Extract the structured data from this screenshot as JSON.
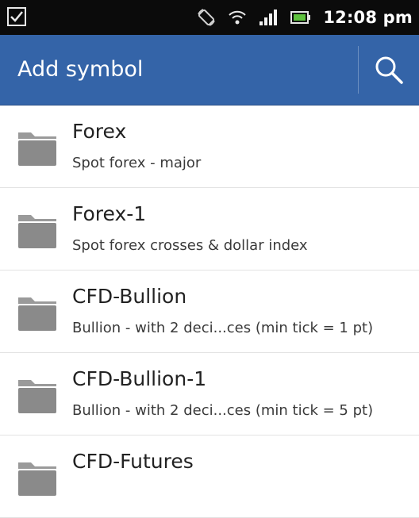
{
  "status_bar": {
    "time": "12:08 pm",
    "icons": [
      "checkbox-notification-icon",
      "rotation-icon",
      "wifi-icon",
      "signal-icon",
      "battery-icon"
    ]
  },
  "action_bar": {
    "title": "Add symbol",
    "search_icon": "search-icon",
    "color": "#3464a8"
  },
  "folders": [
    {
      "name": "Forex",
      "description": "Spot forex - major"
    },
    {
      "name": "Forex-1",
      "description": "Spot forex crosses & dollar index"
    },
    {
      "name": "CFD-Bullion",
      "description": "Bullion - with 2 deci...ces (min tick = 1 pt)"
    },
    {
      "name": "CFD-Bullion-1",
      "description": "Bullion - with 2 deci...ces (min tick = 5 pt)"
    },
    {
      "name": "CFD-Futures",
      "description": ""
    }
  ]
}
